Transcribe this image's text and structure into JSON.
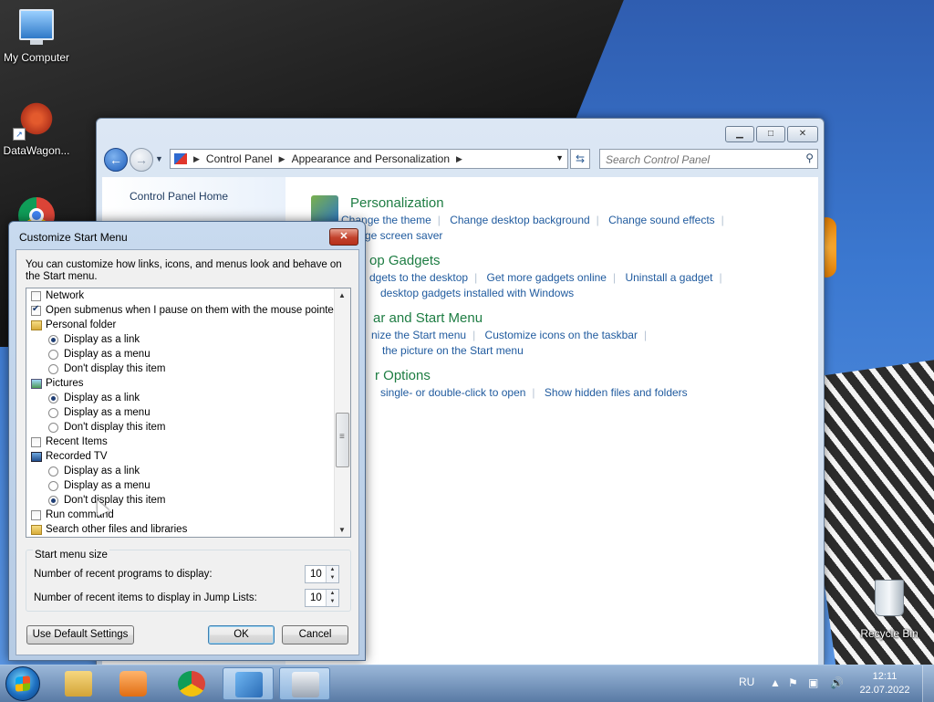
{
  "desktop": {
    "icons": [
      {
        "label": "My Computer"
      },
      {
        "label": "DataWagon..."
      },
      {
        "label": "Recycle Bin"
      }
    ]
  },
  "control_panel": {
    "address": {
      "segments": [
        "Control Panel",
        "Appearance and Personalization"
      ]
    },
    "search_placeholder": "Search Control Panel",
    "left_nav": {
      "home": "Control Panel Home"
    },
    "categories": [
      {
        "title": "Personalization",
        "rows": [
          [
            "Change the theme",
            "Change desktop background",
            "Change sound effects"
          ],
          [
            "ge screen saver"
          ]
        ]
      },
      {
        "title": "op Gadgets",
        "rows": [
          [
            "dgets to the desktop",
            "Get more gadgets online",
            "Uninstall a gadget"
          ],
          [
            "desktop gadgets installed with Windows"
          ]
        ]
      },
      {
        "title": "ar and Start Menu",
        "rows": [
          [
            "nize the Start menu",
            "Customize icons on the taskbar"
          ],
          [
            "the picture on the Start menu"
          ]
        ]
      },
      {
        "title": "r Options",
        "rows": [
          [
            "single- or double-click to open",
            "Show hidden files and folders"
          ]
        ]
      }
    ]
  },
  "dialog": {
    "title": "Customize Start Menu",
    "close_label": "✕",
    "description": "You can customize how links, icons, and menus look and behave on the Start menu.",
    "options": [
      {
        "kind": "check",
        "label": "Network",
        "checked": false,
        "indent": 0
      },
      {
        "kind": "check",
        "label": "Open submenus when I pause on them with the mouse pointer",
        "checked": true,
        "indent": 0
      },
      {
        "kind": "folder",
        "icon": "folder-icon",
        "label": "Personal folder",
        "indent": 0
      },
      {
        "kind": "radio",
        "label": "Display as a link",
        "checked": true,
        "indent": 1
      },
      {
        "kind": "radio",
        "label": "Display as a menu",
        "checked": false,
        "indent": 1
      },
      {
        "kind": "radio",
        "label": "Don't display this item",
        "checked": false,
        "indent": 1
      },
      {
        "kind": "folder",
        "icon": "pictures-icon",
        "label": "Pictures",
        "indent": 0
      },
      {
        "kind": "radio",
        "label": "Display as a link",
        "checked": true,
        "indent": 1
      },
      {
        "kind": "radio",
        "label": "Display as a menu",
        "checked": false,
        "indent": 1
      },
      {
        "kind": "radio",
        "label": "Don't display this item",
        "checked": false,
        "indent": 1
      },
      {
        "kind": "check",
        "label": "Recent Items",
        "checked": false,
        "indent": 0
      },
      {
        "kind": "folder",
        "icon": "recorded-tv-icon",
        "label": "Recorded TV",
        "indent": 0
      },
      {
        "kind": "radio",
        "label": "Display as a link",
        "checked": false,
        "indent": 1
      },
      {
        "kind": "radio",
        "label": "Display as a menu",
        "checked": false,
        "indent": 1
      },
      {
        "kind": "radio",
        "label": "Don't display this item",
        "checked": true,
        "indent": 1
      },
      {
        "kind": "check",
        "label": "Run command",
        "checked": false,
        "indent": 0
      },
      {
        "kind": "folder",
        "icon": "folder-icon",
        "label": "Search other files and libraries",
        "indent": 0
      }
    ],
    "start_menu_size": {
      "legend": "Start menu size",
      "recent_programs_label": "Number of recent programs to display:",
      "recent_programs_value": "10",
      "recent_items_label": "Number of recent items to display in Jump Lists:",
      "recent_items_value": "10"
    },
    "buttons": {
      "defaults": "Use Default Settings",
      "ok": "OK",
      "cancel": "Cancel"
    }
  },
  "taskbar": {
    "apps": [
      {
        "name": "windows-explorer",
        "active": false
      },
      {
        "name": "media-player",
        "active": false
      },
      {
        "name": "google-chrome",
        "active": false
      },
      {
        "name": "control-panel",
        "active": true
      },
      {
        "name": "customize-dialog",
        "active": true
      }
    ],
    "language": "RU",
    "time": "12:11",
    "date": "22.07.2022"
  }
}
